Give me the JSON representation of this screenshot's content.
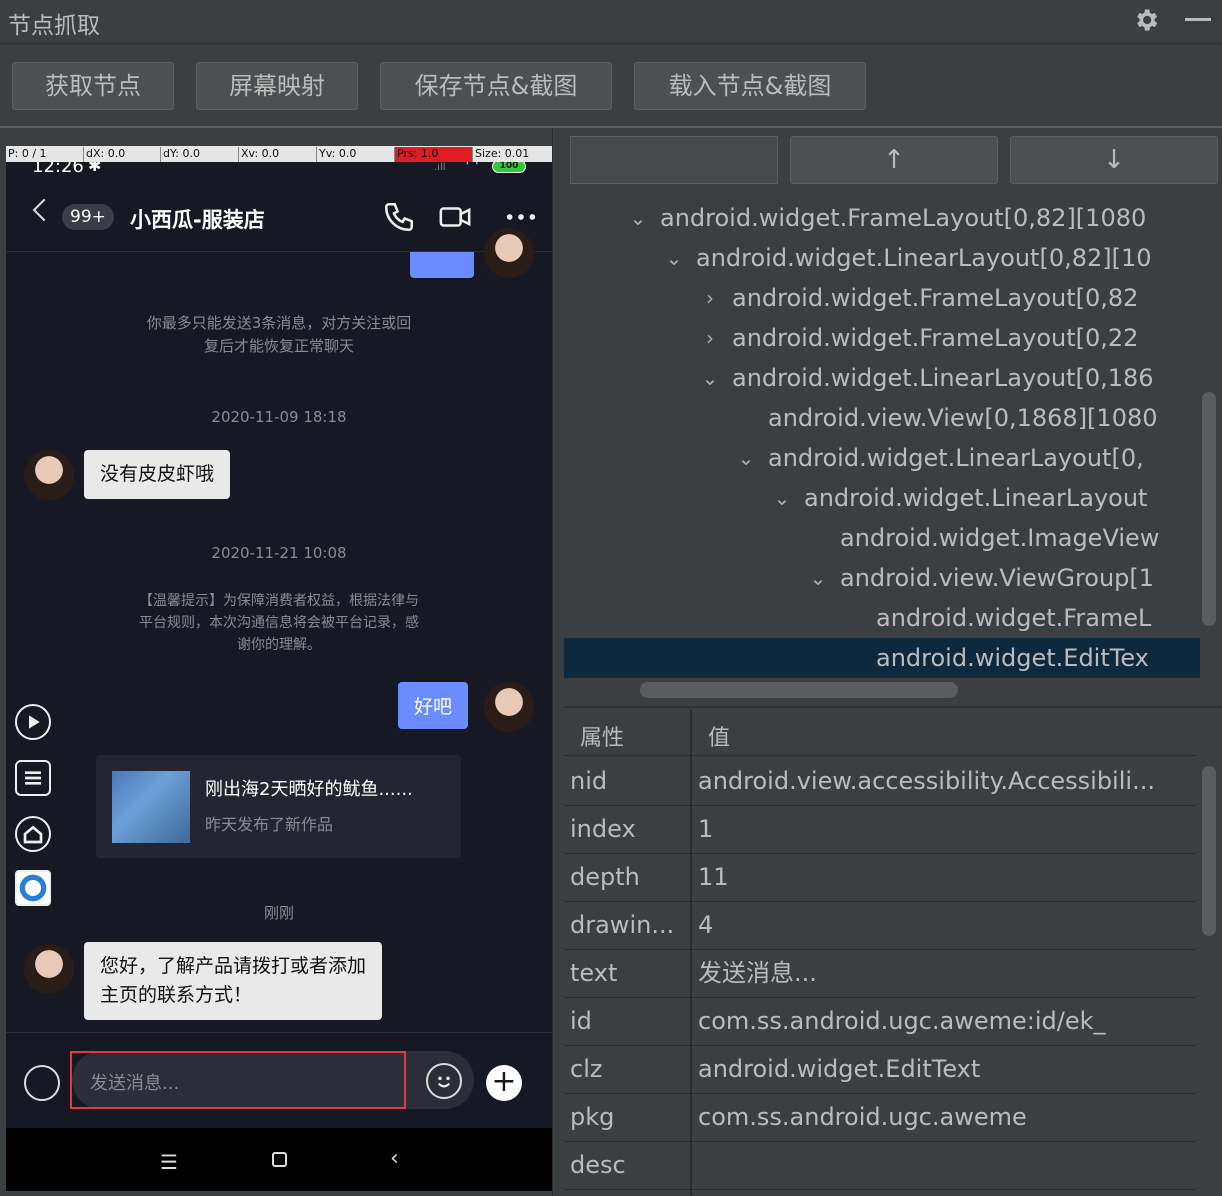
{
  "window": {
    "title": "节点抓取",
    "icons": [
      "gear-icon",
      "minimize-icon"
    ]
  },
  "toolbar": {
    "get_nodes": "获取节点",
    "screen_map": "屏幕映射",
    "save_nodes": "保存节点&截图",
    "load_nodes": "载入节点&截图"
  },
  "phone": {
    "coords": {
      "p": "P: 0 / 1",
      "dx": "dX: 0.0",
      "dy": "dY: 0.0",
      "xv": "Xv: 0.0",
      "yv": "Yv: 0.0",
      "prs": "Prs: 1.0",
      "size": "Size: 0.01"
    },
    "status": {
      "time": "12:26",
      "battery": "100"
    },
    "header": {
      "unread": "99+",
      "name": "小西瓜-服装店"
    },
    "messages": {
      "limit_notice_1": "你最多只能发送3条消息，对方关注或回",
      "limit_notice_2": "复后才能恢复正常聊天",
      "time1": "2020-11-09 18:18",
      "msg1": "没有皮皮虾哦",
      "time2": "2020-11-21 10:08",
      "notice_1": "【温馨提示】为保障消费者权益，根据法律与",
      "notice_2": "平台规则，本次沟通信息将会被平台记录，感",
      "notice_3": "谢你的理解。",
      "msg_out": "好吧",
      "card_title": "刚出海2天晒好的鱿鱼......",
      "card_sub": "昨天发布了新作品",
      "time3": "刚刚",
      "msg2_line1": "您好，了解产品请拨打或者添加",
      "msg2_line2": "主页的联系方式！"
    },
    "input": {
      "placeholder": "发送消息..."
    }
  },
  "panel": {
    "up": "↑",
    "down": "↓",
    "tree": [
      {
        "arrow": "⌄",
        "text": "android.widget.FrameLayout[0,82][1080"
      },
      {
        "arrow": "⌄",
        "text": "android.widget.LinearLayout[0,82][10"
      },
      {
        "arrow": "›",
        "text": "android.widget.FrameLayout[0,82"
      },
      {
        "arrow": "›",
        "text": "android.widget.FrameLayout[0,22"
      },
      {
        "arrow": "⌄",
        "text": "android.widget.LinearLayout[0,186"
      },
      {
        "arrow": "",
        "text": "android.view.View[0,1868][1080"
      },
      {
        "arrow": "⌄",
        "text": "android.widget.LinearLayout[0,"
      },
      {
        "arrow": "⌄",
        "text": "android.widget.LinearLayout"
      },
      {
        "arrow": "",
        "text": "android.widget.ImageView"
      },
      {
        "arrow": "⌄",
        "text": "android.view.ViewGroup[1"
      },
      {
        "arrow": "",
        "text": "android.widget.FrameL"
      },
      {
        "arrow": "",
        "text": "android.widget.EditTex"
      }
    ],
    "props_header": {
      "key": "属性",
      "value": "值"
    },
    "props": [
      {
        "k": "nid",
        "v": "android.view.accessibility.Accessibili..."
      },
      {
        "k": "index",
        "v": "1"
      },
      {
        "k": "depth",
        "v": "11"
      },
      {
        "k": "drawin...",
        "v": "4"
      },
      {
        "k": "text",
        "v": "发送消息..."
      },
      {
        "k": "id",
        "v": "com.ss.android.ugc.aweme:id/ek_"
      },
      {
        "k": "clz",
        "v": "android.widget.EditText"
      },
      {
        "k": "pkg",
        "v": "com.ss.android.ugc.aweme"
      },
      {
        "k": "desc",
        "v": ""
      }
    ]
  }
}
